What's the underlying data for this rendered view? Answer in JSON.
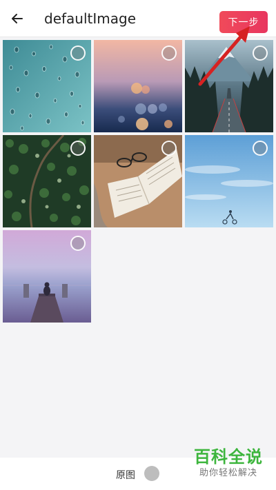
{
  "header": {
    "title": "defaultImage",
    "back_icon": "arrow-left-icon",
    "next_label": "下一步",
    "next_color": "#ee3f5c"
  },
  "photos": [
    {
      "subject": "water droplets"
    },
    {
      "subject": "sunset bokeh"
    },
    {
      "subject": "mountain road"
    },
    {
      "subject": "forest aerial"
    },
    {
      "subject": "open book with glasses"
    },
    {
      "subject": "blue sky with cyclist"
    },
    {
      "subject": "person on pier at dusk"
    }
  ],
  "footer": {
    "original_label": "原图"
  },
  "watermark": {
    "big": "百科全说",
    "small": "助你轻松解决"
  },
  "colors": {
    "annotation": "#d62222",
    "watermark_green": "#3db53d"
  }
}
